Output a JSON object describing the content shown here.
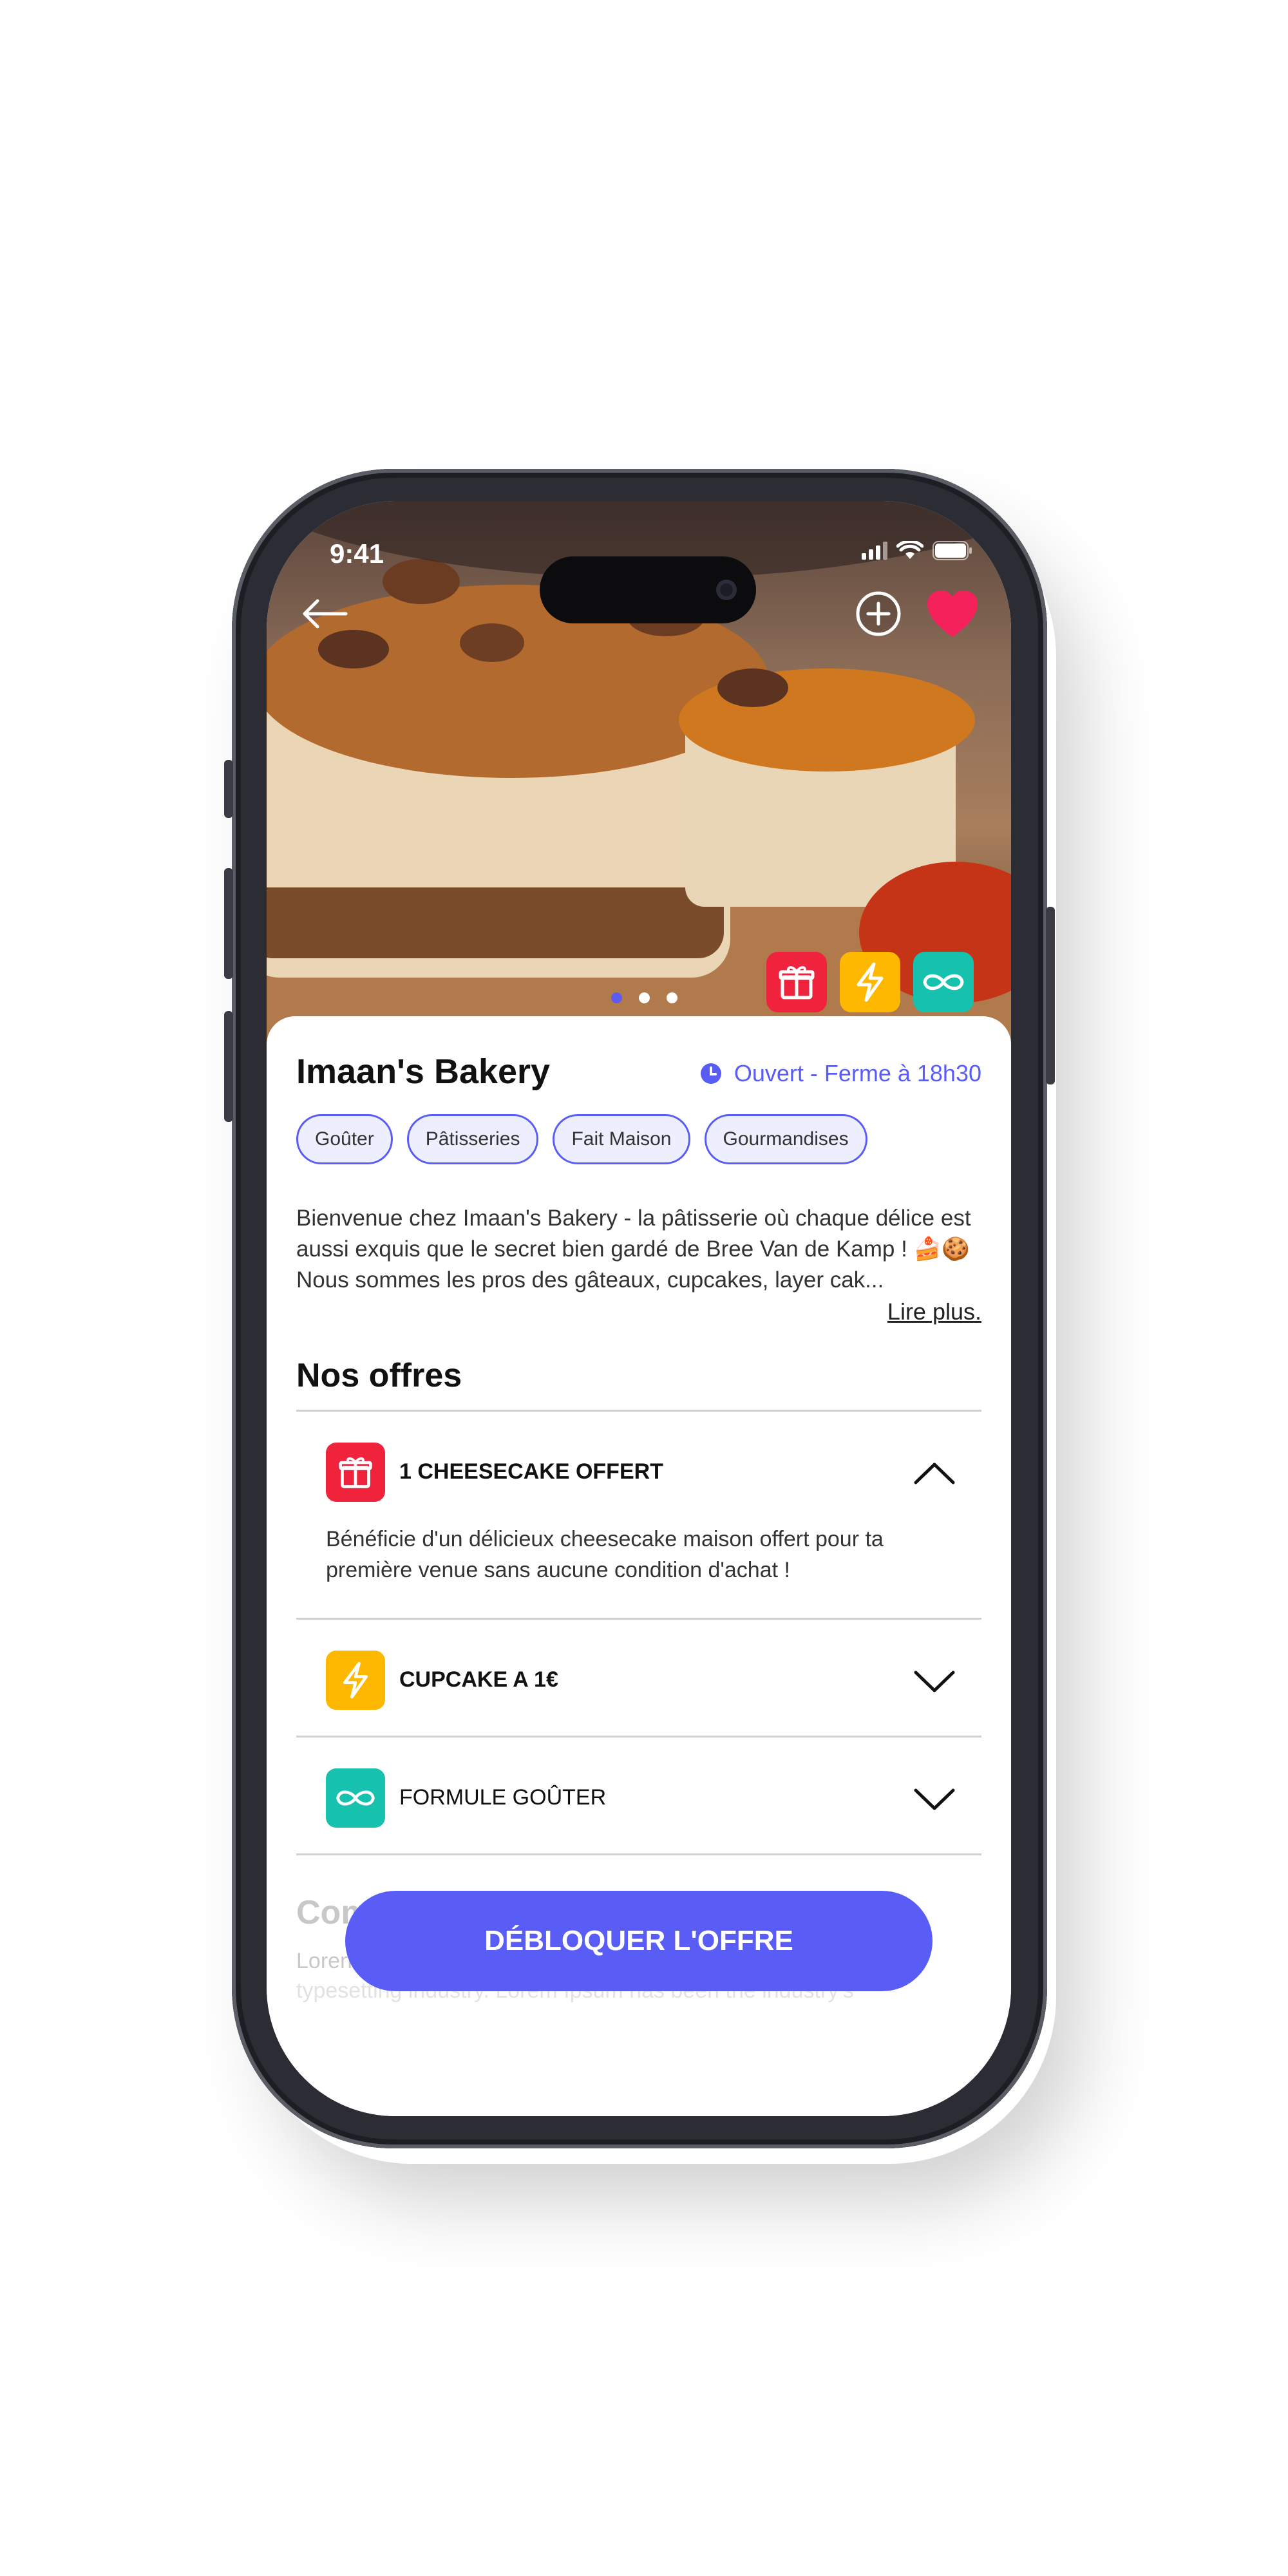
{
  "status_bar": {
    "time": "9:41"
  },
  "header": {
    "back_icon": "arrow-left-icon",
    "add_icon": "plus-circle-icon",
    "favorite_icon": "heart-icon"
  },
  "hero": {
    "carousel_pages": 3,
    "carousel_active_index": 0
  },
  "store": {
    "name": "Imaan's Bakery",
    "open_status": "Ouvert - Ferme à 18h30",
    "tags": [
      "Goûter",
      "Pâtisseries",
      "Fait Maison",
      "Gourmandises"
    ],
    "description": "Bienvenue chez Imaan's Bakery - la pâtisserie où chaque délice est aussi exquis que le secret bien gardé de Bree Van de Kamp ! 🍰🍪 Nous sommes les pros des gâteaux, cupcakes, layer cak...",
    "read_more": "Lire plus."
  },
  "offers_section": {
    "title": "Nos offres",
    "items": [
      {
        "icon": "gift-icon",
        "color": "#f0233c",
        "label": "1 CHEESECAKE OFFERT",
        "expanded": true,
        "description": "Bénéficie d'un délicieux cheesecake maison offert pour ta première venue sans aucune condition d'achat !"
      },
      {
        "icon": "lightning-icon",
        "color": "#ffb800",
        "label": "CUPCAKE A 1€",
        "expanded": false
      },
      {
        "icon": "infinity-icon",
        "color": "#16c1ad",
        "label": "FORMULE GOÛTER",
        "expanded": false
      }
    ]
  },
  "next_section": {
    "title_partial": "Com",
    "text_partial": "Loren",
    "text_partial_2": "typesetting industry. Lorem Ipsum has been the industry's"
  },
  "cta": {
    "label": "DÉBLOQUER L'OFFRE"
  },
  "colors": {
    "accent": "#5a5cf6",
    "favorite": "#f5215a",
    "gift": "#f0233c",
    "flash": "#ffb800",
    "infinity": "#16c1ad"
  }
}
